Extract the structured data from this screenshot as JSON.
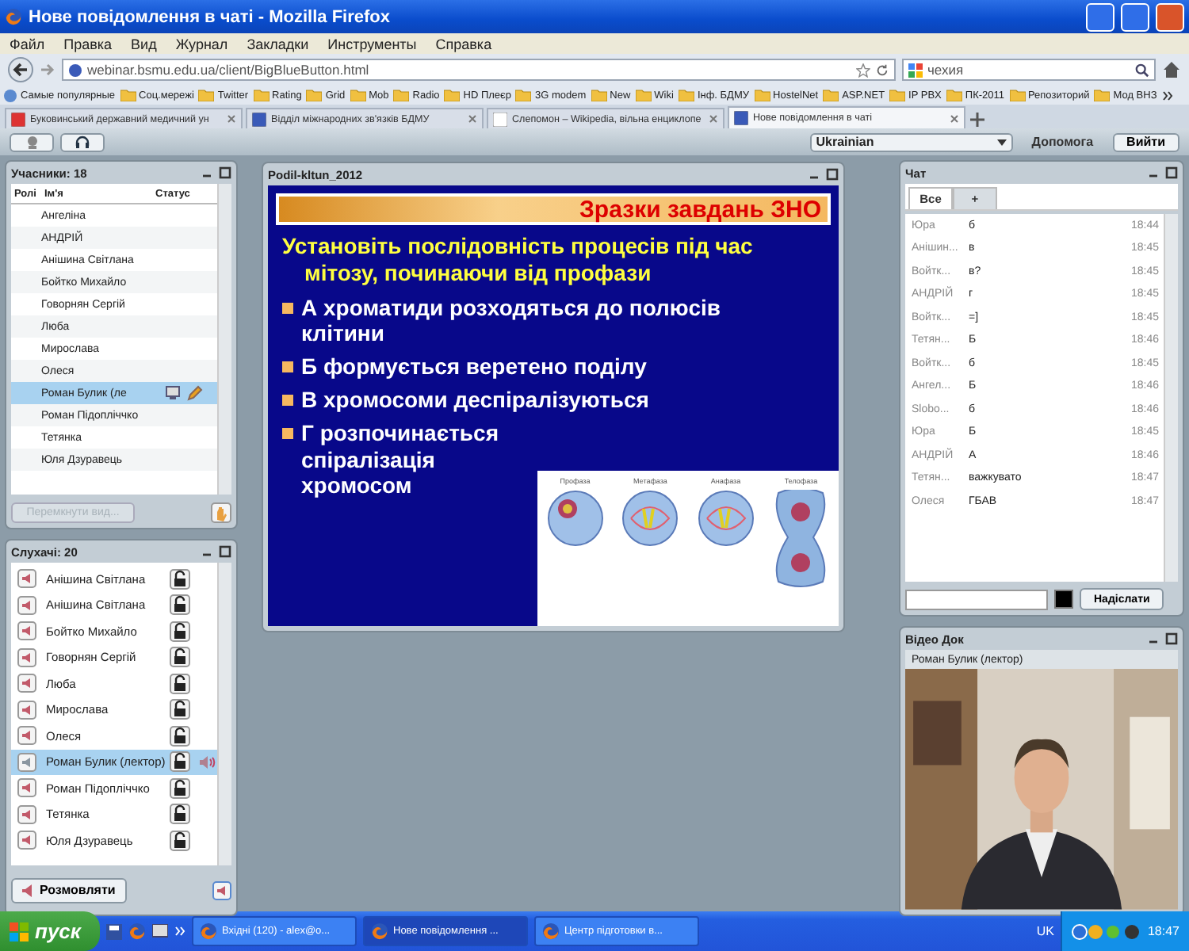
{
  "window": {
    "title": "Нове повідомлення в чаті - Mozilla Firefox"
  },
  "menu": [
    "Файл",
    "Правка",
    "Вид",
    "Журнал",
    "Закладки",
    "Инструменты",
    "Справка"
  ],
  "address": {
    "value": "webinar.bsmu.edu.ua/client/BigBlueButton.html"
  },
  "search": {
    "value": "чехия"
  },
  "bookmarks": [
    "Самые популярные",
    "Соц.мережі",
    "Twitter",
    "Rating",
    "Grid",
    "Mob",
    "Radio",
    "HD Плеєр",
    "3G modem",
    "New",
    "Wiki",
    "Інф. БДМУ",
    "HostelNet",
    "ASP.NET",
    "IP PBX",
    "ПК-2011",
    "Репозиторий",
    "Мод ВНЗ"
  ],
  "tabs": [
    {
      "label": "Буковинський державний медичний ун",
      "selected": false
    },
    {
      "label": "Відділ міжнародних зв'язків БДМУ",
      "selected": false
    },
    {
      "label": "Слепомон – Wikipedia, вільна енциклопе",
      "selected": false
    },
    {
      "label": "Нове повідомлення в чаті",
      "selected": true
    }
  ],
  "toolbar": {
    "language": "Ukrainian",
    "help": "Допомога",
    "logout": "Вийти"
  },
  "participants": {
    "title": "Учасники: 18",
    "columns": [
      "Ролі",
      "Ім'я",
      "Статус"
    ],
    "rows": [
      {
        "name": "Ангеліна",
        "selected": false,
        "presenter": false
      },
      {
        "name": "АНДРІЙ",
        "selected": false,
        "presenter": false
      },
      {
        "name": "Анішина Світлана",
        "selected": false,
        "presenter": false
      },
      {
        "name": "Бойтко Михайло",
        "selected": false,
        "presenter": false
      },
      {
        "name": "Говорнян Сергій",
        "selected": false,
        "presenter": false
      },
      {
        "name": "Люба",
        "selected": false,
        "presenter": false
      },
      {
        "name": "Мирослава",
        "selected": false,
        "presenter": false
      },
      {
        "name": "Олеся",
        "selected": false,
        "presenter": false
      },
      {
        "name": "Роман Булик (ле",
        "selected": true,
        "presenter": true
      },
      {
        "name": "Роман Підопліччко",
        "selected": false,
        "presenter": false
      },
      {
        "name": "Тетянка",
        "selected": false,
        "presenter": false
      },
      {
        "name": "Юля Дзуравець",
        "selected": false,
        "presenter": false
      }
    ],
    "button": {
      "label": "Перемкнути вид...",
      "disabled": true
    }
  },
  "listeners": {
    "title": "Слухачі: 20",
    "rows": [
      {
        "name": "Анішина Світлана",
        "selected": false,
        "muted": true,
        "talking": false
      },
      {
        "name": "Анішина Світлана",
        "selected": false,
        "muted": true,
        "talking": false
      },
      {
        "name": "Бойтко Михайло",
        "selected": false,
        "muted": true,
        "talking": false
      },
      {
        "name": "Говорнян Сергій",
        "selected": false,
        "muted": true,
        "talking": false
      },
      {
        "name": "Люба",
        "selected": false,
        "muted": true,
        "talking": false
      },
      {
        "name": "Мирослава",
        "selected": false,
        "muted": true,
        "talking": false
      },
      {
        "name": "Олеся",
        "selected": false,
        "muted": true,
        "talking": false
      },
      {
        "name": "Роман Булик (лектор)",
        "selected": true,
        "muted": false,
        "talking": true
      },
      {
        "name": "Роман Підопліччко",
        "selected": false,
        "muted": true,
        "talking": false
      },
      {
        "name": "Тетянка",
        "selected": false,
        "muted": true,
        "talking": false
      },
      {
        "name": "Юля Дзуравець",
        "selected": false,
        "muted": true,
        "talking": false
      }
    ],
    "button": "Розмовляти"
  },
  "slide": {
    "title": "Podil-kltun_2012",
    "heading": "Зразки завдань ЗНО",
    "question": "Установіть послідовність процесів під час мітозу, починаючи від профази",
    "bullets": [
      "А хроматиди розходяться до полюсів клітини",
      "Б формується веретено поділу",
      "В хромосоми деспіралізуються",
      "Г розпочинається спіралізація хромосом"
    ],
    "phases": [
      "Профаза",
      "Метафаза",
      "Анафаза",
      "Телофаза"
    ]
  },
  "chat": {
    "title": "Чат",
    "tabs": [
      {
        "label": "Все",
        "selected": true
      },
      {
        "label": "+",
        "selected": false
      }
    ],
    "messages": [
      {
        "name": "Юра",
        "text": "б",
        "time": "18:44"
      },
      {
        "name": "Анішин...",
        "text": "в",
        "time": "18:45"
      },
      {
        "name": "Войтк...",
        "text": "в?",
        "time": "18:45"
      },
      {
        "name": "АНДРІЙ",
        "text": "г",
        "time": "18:45"
      },
      {
        "name": "Войтк...",
        "text": "=]",
        "time": "18:45"
      },
      {
        "name": "Тетян...",
        "text": "Б",
        "time": "18:46"
      },
      {
        "name": "Войтк...",
        "text": "б",
        "time": "18:45"
      },
      {
        "name": "Ангел...",
        "text": "Б",
        "time": "18:46"
      },
      {
        "name": "Slobo...",
        "text": "б",
        "time": "18:46"
      },
      {
        "name": "Юра",
        "text": "Б",
        "time": "18:45"
      },
      {
        "name": "АНДРІЙ",
        "text": "А",
        "time": "18:46"
      },
      {
        "name": "Тетян...",
        "text": "важкувато",
        "time": "18:47"
      },
      {
        "name": "Олеся",
        "text": "ГБАВ",
        "time": "18:47"
      }
    ],
    "send": "Надіслати"
  },
  "video": {
    "title": "Відео Док",
    "caption": "Роман Булик (лектор)"
  },
  "taskbar": {
    "start": "пуск",
    "tasks": [
      {
        "label": "Вхідні (120) - alex@o...",
        "selected": false
      },
      {
        "label": "Нове повідомлення ...",
        "selected": true
      },
      {
        "label": "Центр підготовки в...",
        "selected": false
      }
    ],
    "language": "UK",
    "time": "18:47"
  }
}
